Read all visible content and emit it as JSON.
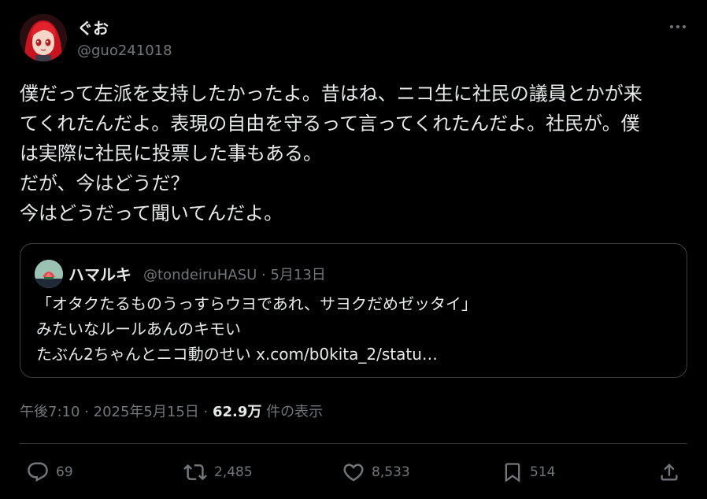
{
  "author": {
    "display_name": "ぐお",
    "handle": "@guo241018",
    "avatar_icon": "anime-avatar-icon"
  },
  "tweet": {
    "lines": [
      "僕だって左派を支持したかったよ。昔はね、ニコ生に社民の議員とかが来",
      "てくれたんだよ。表現の自由を守るって言ってくれたんだよ。社民が。僕",
      "は実際に社民に投票した事もある。",
      "だが、今はどうだ？",
      "今はどうだって聞いてんだよ。"
    ]
  },
  "quote": {
    "display_name": "ハマルキ",
    "handle": "@tondeiruHASU",
    "separator": "·",
    "date": "5月13日",
    "lines": [
      "「オタクたるものうっすらウヨであれ、サヨクだめゼッタイ」",
      "みたいなルールあんのキモい",
      "たぶん2ちゃんとニコ動のせい x.com/b0kita_2/statu…"
    ]
  },
  "meta": {
    "time": "午後7:10",
    "sep1": "·",
    "date": "2025年5月15日",
    "sep2": "·",
    "views": "62.9万",
    "views_label": "件の表示"
  },
  "actions": {
    "replies": "69",
    "retweets": "2,485",
    "likes": "8,533",
    "bookmarks": "514"
  },
  "colors": {
    "background": "#000000",
    "text": "#e7e9ea",
    "muted": "#71767b",
    "border": "#3c4043"
  }
}
